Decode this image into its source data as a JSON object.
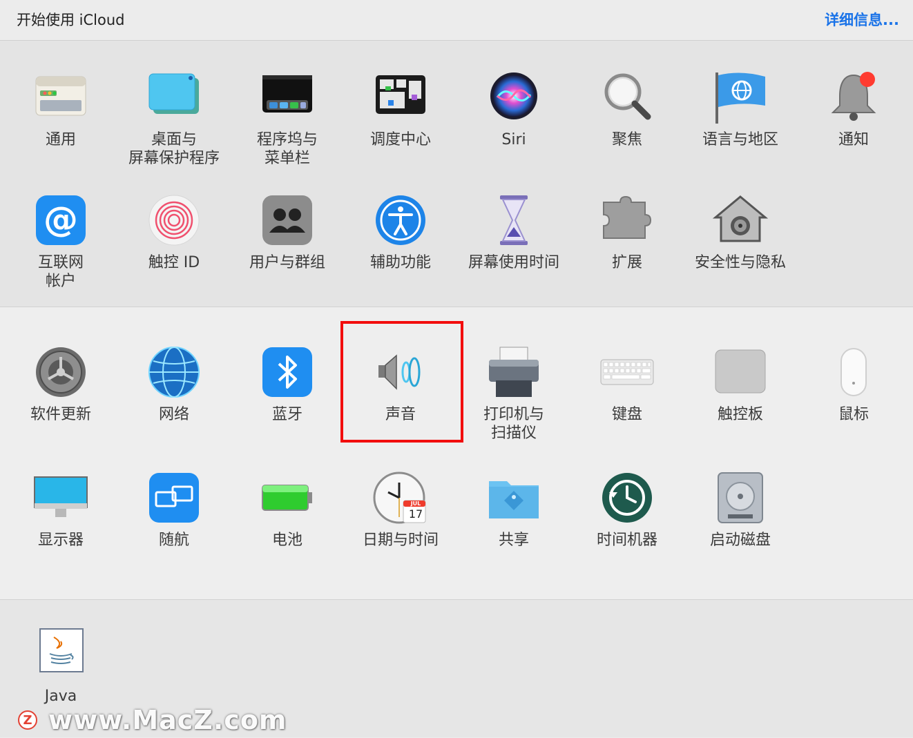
{
  "header": {
    "left_text": "开始使用 iCloud",
    "right_link": "详细信息..."
  },
  "section1": [
    {
      "label": "通用",
      "icon": "general-icon"
    },
    {
      "label": "桌面与\n屏幕保护程序",
      "icon": "desktop-screensaver-icon"
    },
    {
      "label": "程序坞与\n菜单栏",
      "icon": "dock-menubar-icon"
    },
    {
      "label": "调度中心",
      "icon": "mission-control-icon"
    },
    {
      "label": "Siri",
      "icon": "siri-icon"
    },
    {
      "label": "聚焦",
      "icon": "spotlight-icon"
    },
    {
      "label": "语言与地区",
      "icon": "language-region-icon"
    },
    {
      "label": "通知",
      "icon": "notifications-icon"
    },
    {
      "label": "互联网\n帐户",
      "icon": "internet-accounts-icon"
    },
    {
      "label": "触控 ID",
      "icon": "touch-id-icon"
    },
    {
      "label": "用户与群组",
      "icon": "users-groups-icon"
    },
    {
      "label": "辅助功能",
      "icon": "accessibility-icon"
    },
    {
      "label": "屏幕使用时间",
      "icon": "screen-time-icon"
    },
    {
      "label": "扩展",
      "icon": "extensions-icon"
    },
    {
      "label": "安全性与隐私",
      "icon": "security-privacy-icon"
    }
  ],
  "section2": [
    {
      "label": "软件更新",
      "icon": "software-update-icon"
    },
    {
      "label": "网络",
      "icon": "network-icon"
    },
    {
      "label": "蓝牙",
      "icon": "bluetooth-icon"
    },
    {
      "label": "声音",
      "icon": "sound-icon"
    },
    {
      "label": "打印机与\n扫描仪",
      "icon": "printers-scanners-icon"
    },
    {
      "label": "键盘",
      "icon": "keyboard-icon"
    },
    {
      "label": "触控板",
      "icon": "trackpad-icon"
    },
    {
      "label": "鼠标",
      "icon": "mouse-icon"
    },
    {
      "label": "显示器",
      "icon": "displays-icon"
    },
    {
      "label": "随航",
      "icon": "sidecar-icon"
    },
    {
      "label": "电池",
      "icon": "battery-icon"
    },
    {
      "label": "日期与时间",
      "icon": "date-time-icon"
    },
    {
      "label": "共享",
      "icon": "sharing-icon"
    },
    {
      "label": "时间机器",
      "icon": "time-machine-icon"
    },
    {
      "label": "启动磁盘",
      "icon": "startup-disk-icon"
    }
  ],
  "section3": [
    {
      "label": "Java",
      "icon": "java-icon"
    }
  ],
  "calendar_icon": {
    "month": "JUL",
    "day": "17"
  },
  "watermark": {
    "logo": "Z",
    "text": "www.MacZ.com"
  },
  "colors": {
    "highlight": "#f20d0d",
    "link": "#1a73e8"
  }
}
